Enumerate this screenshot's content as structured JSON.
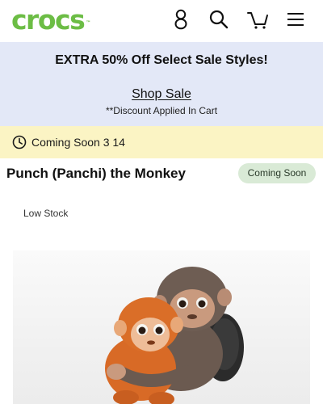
{
  "header": {
    "logo_text": "crocs",
    "logo_tm": "™",
    "icons": [
      "account-icon",
      "search-icon",
      "cart-icon",
      "menu-icon"
    ],
    "brand_color": "#6cbd45"
  },
  "promo": {
    "headline": "EXTRA 50% Off Select Sale Styles!",
    "link_label": "Shop Sale",
    "note": "**Discount Applied In Cart",
    "background": "#e3e8f7"
  },
  "coming_soon_bar": {
    "icon": "clock-icon",
    "text": "Coming Soon 3 14",
    "background": "#fbf4c4"
  },
  "product": {
    "title": "Punch (Panchi) the Monkey",
    "badge": "Coming Soon",
    "stock_status": "Low Stock",
    "image_subject": "monkey-charm-image"
  }
}
